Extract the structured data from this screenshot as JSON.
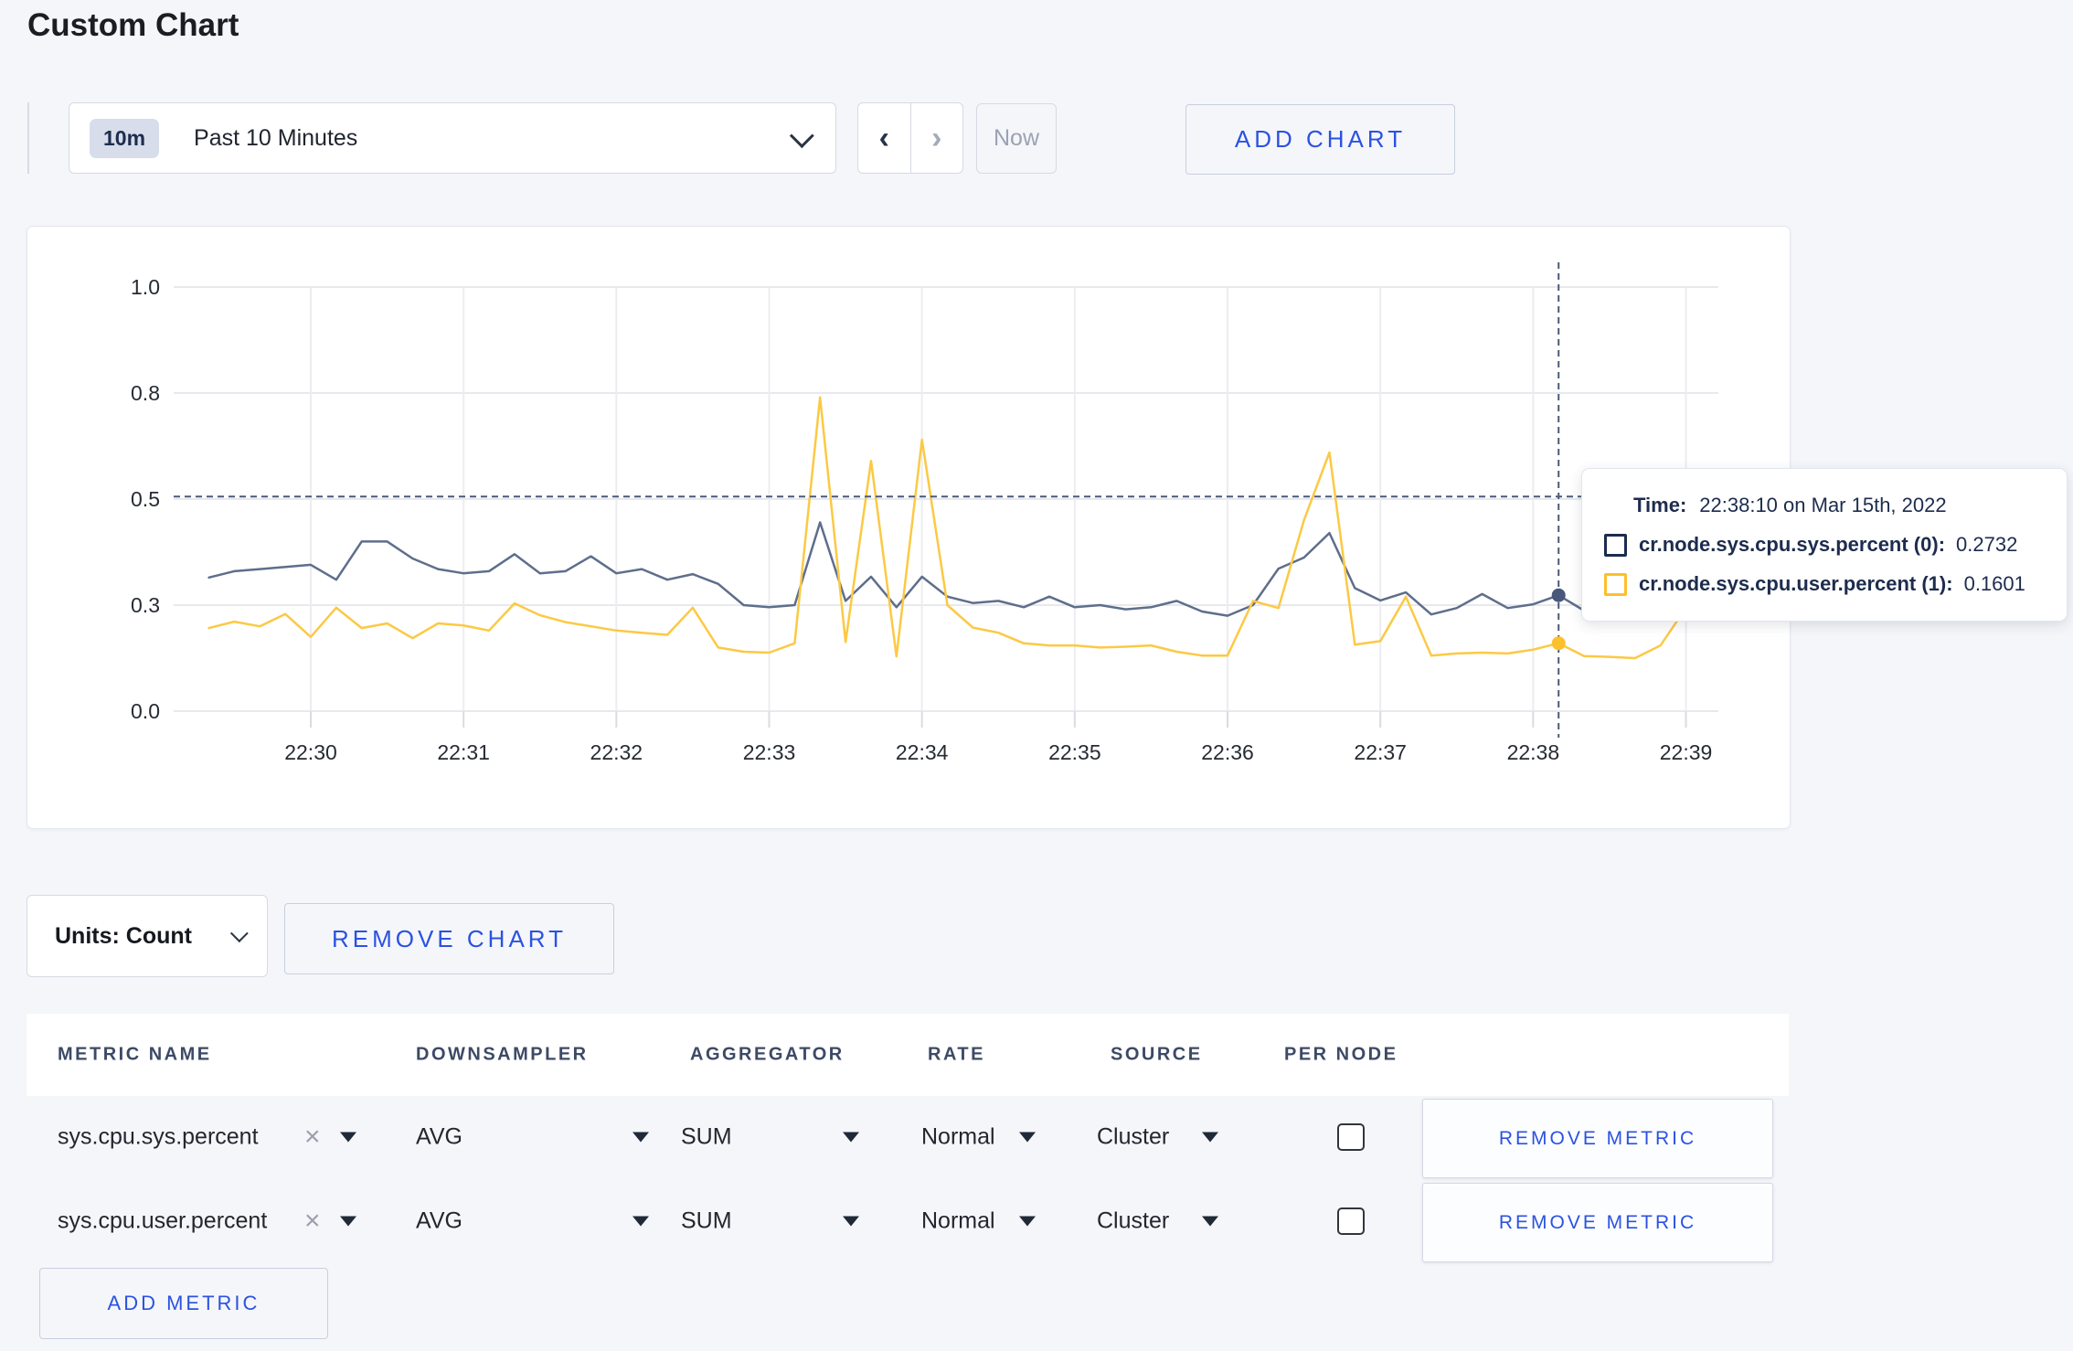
{
  "page": {
    "title": "Custom Chart",
    "background": "#f5f6fa",
    "accent_blue": "#2b52e1"
  },
  "toolbar": {
    "time_window_badge": "10m",
    "time_window_label": "Past 10 Minutes",
    "prev_arrow": "‹",
    "next_arrow": "›",
    "now_label": "Now",
    "add_chart_label": "ADD CHART"
  },
  "tooltip": {
    "time_label": "Time:",
    "time_value": "22:38:10 on Mar 15th, 2022",
    "rows": [
      {
        "label": "cr.node.sys.cpu.sys.percent (0):",
        "value": "0.2732",
        "swatch": "#1c2c4e"
      },
      {
        "label": "cr.node.sys.cpu.user.percent (1):",
        "value": "0.1601",
        "swatch": "#fdc02c"
      }
    ]
  },
  "units": {
    "label": "Units: Count",
    "remove_chart_label": "REMOVE CHART"
  },
  "metrics_table": {
    "headers": [
      "METRIC NAME",
      "DOWNSAMPLER",
      "AGGREGATOR",
      "RATE",
      "SOURCE",
      "PER NODE"
    ],
    "rows": [
      {
        "name": "sys.cpu.sys.percent",
        "downsampler": "AVG",
        "aggregator": "SUM",
        "rate": "Normal",
        "source": "Cluster",
        "per_node_checked": false,
        "remove_label": "REMOVE METRIC"
      },
      {
        "name": "sys.cpu.user.percent",
        "downsampler": "AVG",
        "aggregator": "SUM",
        "rate": "Normal",
        "source": "Cluster",
        "per_node_checked": false,
        "remove_label": "REMOVE METRIC"
      }
    ],
    "add_metric_label": "ADD METRIC"
  },
  "chart_data": {
    "type": "line",
    "ylim": [
      0,
      1
    ],
    "grid": true,
    "y_ticks": [
      {
        "label": "0.0",
        "value": 0
      },
      {
        "label": "0.3",
        "value": 0.25
      },
      {
        "label": "0.5",
        "value": 0.5
      },
      {
        "label": "0.8",
        "value": 0.75
      },
      {
        "label": "1.0",
        "value": 1.0
      }
    ],
    "x_ticks": [
      "22:30",
      "22:31",
      "22:32",
      "22:33",
      "22:34",
      "22:35",
      "22:36",
      "22:37",
      "22:38",
      "22:39"
    ],
    "series": [
      {
        "name": "cr.node.sys.cpu.sys.percent (0)",
        "color": "#5e6e8b",
        "points": [
          [
            "22:29:20",
            0.315
          ],
          [
            "22:29:30",
            0.33
          ],
          [
            "22:29:40",
            0.335
          ],
          [
            "22:29:50",
            0.34
          ],
          [
            "22:30:00",
            0.345
          ],
          [
            "22:30:10",
            0.31
          ],
          [
            "22:30:20",
            0.4
          ],
          [
            "22:30:30",
            0.4
          ],
          [
            "22:30:40",
            0.36
          ],
          [
            "22:30:50",
            0.335
          ],
          [
            "22:31:00",
            0.325
          ],
          [
            "22:31:10",
            0.33
          ],
          [
            "22:31:20",
            0.37
          ],
          [
            "22:31:30",
            0.325
          ],
          [
            "22:31:40",
            0.33
          ],
          [
            "22:31:50",
            0.365
          ],
          [
            "22:32:00",
            0.325
          ],
          [
            "22:32:10",
            0.335
          ],
          [
            "22:32:20",
            0.31
          ],
          [
            "22:32:30",
            0.323
          ],
          [
            "22:32:40",
            0.3
          ],
          [
            "22:32:50",
            0.25
          ],
          [
            "22:33:00",
            0.245
          ],
          [
            "22:33:10",
            0.25
          ],
          [
            "22:33:20",
            0.445
          ],
          [
            "22:33:30",
            0.26
          ],
          [
            "22:33:40",
            0.317
          ],
          [
            "22:33:50",
            0.245
          ],
          [
            "22:34:00",
            0.317
          ],
          [
            "22:34:10",
            0.27
          ],
          [
            "22:34:20",
            0.255
          ],
          [
            "22:34:30",
            0.26
          ],
          [
            "22:34:40",
            0.245
          ],
          [
            "22:34:50",
            0.27
          ],
          [
            "22:35:00",
            0.245
          ],
          [
            "22:35:10",
            0.25
          ],
          [
            "22:35:20",
            0.24
          ],
          [
            "22:35:30",
            0.245
          ],
          [
            "22:35:40",
            0.26
          ],
          [
            "22:35:50",
            0.235
          ],
          [
            "22:36:00",
            0.225
          ],
          [
            "22:36:10",
            0.25
          ],
          [
            "22:36:20",
            0.336
          ],
          [
            "22:36:30",
            0.362
          ],
          [
            "22:36:40",
            0.42
          ],
          [
            "22:36:50",
            0.29
          ],
          [
            "22:37:00",
            0.261
          ],
          [
            "22:37:10",
            0.28
          ],
          [
            "22:37:20",
            0.228
          ],
          [
            "22:37:30",
            0.243
          ],
          [
            "22:37:40",
            0.276
          ],
          [
            "22:37:50",
            0.243
          ],
          [
            "22:38:00",
            0.252
          ],
          [
            "22:38:10",
            0.2732
          ],
          [
            "22:38:20",
            0.237
          ],
          [
            "22:38:30",
            0.25
          ],
          [
            "22:38:40",
            0.274
          ],
          [
            "22:38:50",
            0.24
          ],
          [
            "22:39:00",
            0.259
          ],
          [
            "22:39:06",
            0.265
          ]
        ]
      },
      {
        "name": "cr.node.sys.cpu.user.percent (1)",
        "color": "#fcc944",
        "points": [
          [
            "22:29:20",
            0.196
          ],
          [
            "22:29:30",
            0.211
          ],
          [
            "22:29:40",
            0.2
          ],
          [
            "22:29:50",
            0.229
          ],
          [
            "22:30:00",
            0.175
          ],
          [
            "22:30:10",
            0.244
          ],
          [
            "22:30:20",
            0.196
          ],
          [
            "22:30:30",
            0.207
          ],
          [
            "22:30:40",
            0.172
          ],
          [
            "22:30:50",
            0.207
          ],
          [
            "22:31:00",
            0.202
          ],
          [
            "22:31:10",
            0.19
          ],
          [
            "22:31:20",
            0.254
          ],
          [
            "22:31:30",
            0.226
          ],
          [
            "22:31:40",
            0.21
          ],
          [
            "22:31:50",
            0.2
          ],
          [
            "22:32:00",
            0.19
          ],
          [
            "22:32:10",
            0.185
          ],
          [
            "22:32:20",
            0.18
          ],
          [
            "22:32:30",
            0.244
          ],
          [
            "22:32:40",
            0.15
          ],
          [
            "22:32:50",
            0.14
          ],
          [
            "22:33:00",
            0.138
          ],
          [
            "22:33:10",
            0.16
          ],
          [
            "22:33:20",
            0.74
          ],
          [
            "22:33:30",
            0.163
          ],
          [
            "22:33:40",
            0.59
          ],
          [
            "22:33:50",
            0.129
          ],
          [
            "22:34:00",
            0.64
          ],
          [
            "22:34:10",
            0.25
          ],
          [
            "22:34:20",
            0.197
          ],
          [
            "22:34:30",
            0.185
          ],
          [
            "22:34:40",
            0.16
          ],
          [
            "22:34:50",
            0.155
          ],
          [
            "22:35:00",
            0.155
          ],
          [
            "22:35:10",
            0.15
          ],
          [
            "22:35:20",
            0.152
          ],
          [
            "22:35:30",
            0.155
          ],
          [
            "22:35:40",
            0.14
          ],
          [
            "22:35:50",
            0.131
          ],
          [
            "22:36:00",
            0.131
          ],
          [
            "22:36:10",
            0.26
          ],
          [
            "22:36:20",
            0.243
          ],
          [
            "22:36:30",
            0.45
          ],
          [
            "22:36:40",
            0.61
          ],
          [
            "22:36:50",
            0.157
          ],
          [
            "22:37:00",
            0.165
          ],
          [
            "22:37:10",
            0.27
          ],
          [
            "22:37:20",
            0.131
          ],
          [
            "22:37:30",
            0.136
          ],
          [
            "22:37:40",
            0.138
          ],
          [
            "22:37:50",
            0.136
          ],
          [
            "22:38:00",
            0.145
          ],
          [
            "22:38:10",
            0.1601
          ],
          [
            "22:38:20",
            0.13
          ],
          [
            "22:38:30",
            0.128
          ],
          [
            "22:38:40",
            0.125
          ],
          [
            "22:38:50",
            0.155
          ],
          [
            "22:39:00",
            0.243
          ],
          [
            "22:39:06",
            0.215
          ]
        ]
      }
    ],
    "crosshair": {
      "time": "22:38:10",
      "y_value": 0.506,
      "hover_points": [
        {
          "series": 0,
          "value": 0.2732
        },
        {
          "series": 1,
          "value": 0.1601
        }
      ]
    }
  }
}
